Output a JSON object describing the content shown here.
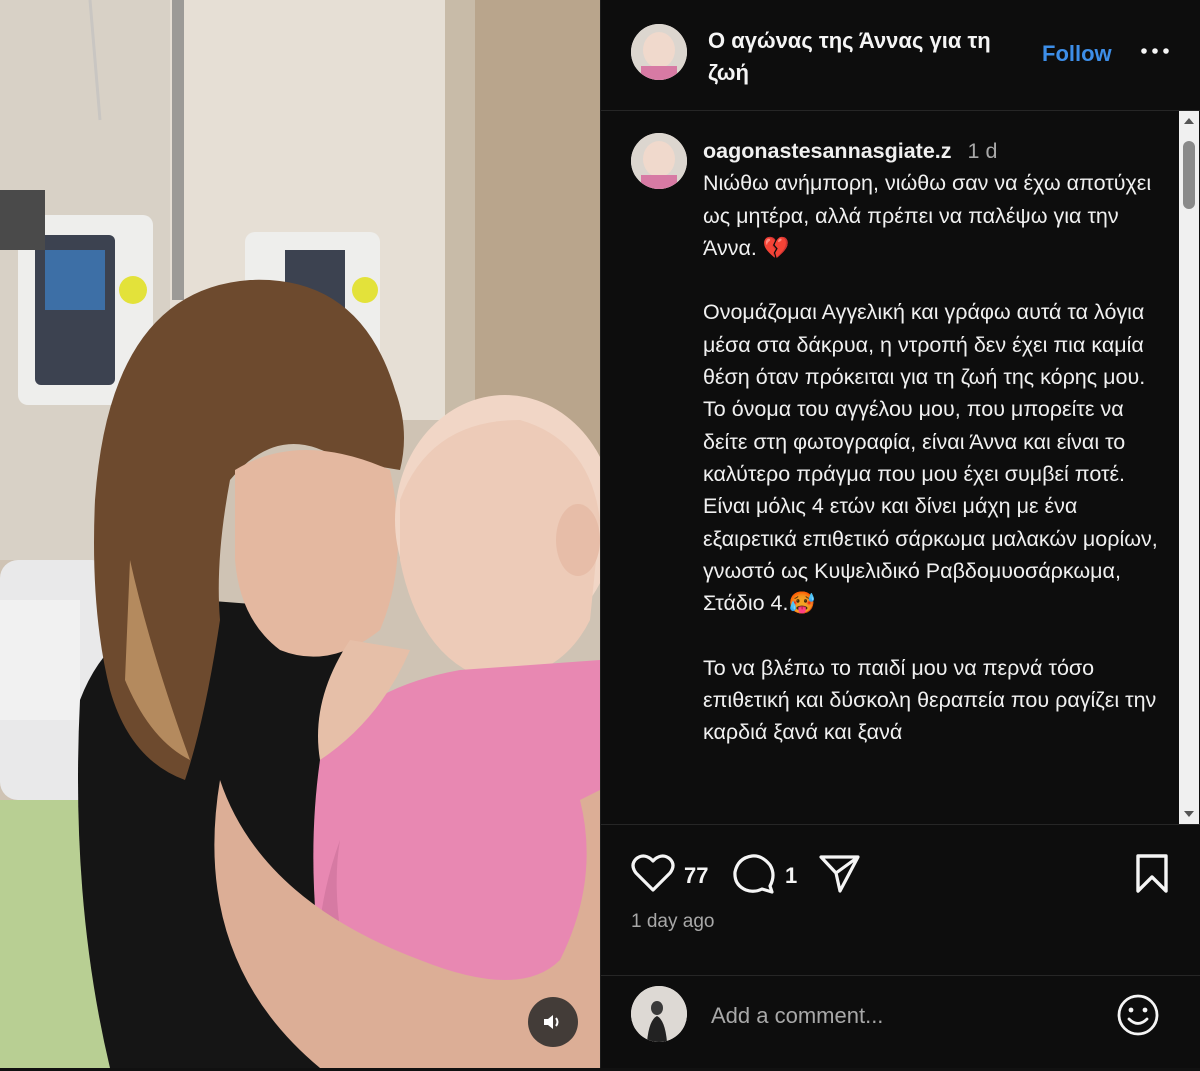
{
  "post": {
    "account_title": "Ο αγώνας της Άννας για τη ζωή",
    "follow_label": "Follow",
    "username": "oagonastesannasgiate.z",
    "time_short": "1 d",
    "caption_paragraphs": [
      "Νιώθω ανήμπορη, νιώθω σαν να έχω αποτύχει ως μητέρα, αλλά πρέπει να παλέψω για την Άννα. 💔",
      "Ονομάζομαι Αγγελική και γράφω αυτά τα λόγια μέσα στα δάκρυα, η ντροπή δεν έχει πια καμία θέση όταν πρόκειται για τη ζωή της κόρης μου.\nΤο όνομα του αγγέλου μου, που μπορείτε να δείτε στη φωτογραφία, είναι Άννα και είναι το καλύτερο πράγμα που μου έχει συμβεί ποτέ.\nΕίναι μόλις 4 ετών και δίνει μάχη με ένα εξαιρετικά επιθετικό σάρκωμα μαλακών μορίων, γνωστό ως Κυψελιδικό Ραβδομυοσάρκωμα, Στάδιο 4.🥵",
      "Το να βλέπω το παιδί μου να περνά τόσο επιθετική και δύσκολη θεραπεία που ραγίζει την καρδιά ξανά και ξανά"
    ],
    "likes_count": "77",
    "comments_count": "1",
    "posted_ago": "1 day ago"
  },
  "comment": {
    "placeholder": "Add a comment..."
  },
  "icons": {
    "more": "more-horizontal-icon",
    "like": "heart-icon",
    "comment": "comment-bubble-icon",
    "share": "send-icon",
    "save": "bookmark-icon",
    "emoji": "smiley-icon",
    "volume": "volume-icon"
  },
  "colors": {
    "background": "#0d0d0d",
    "accent": "#3d8ee8",
    "secondary_text": "#a8a8a8"
  }
}
